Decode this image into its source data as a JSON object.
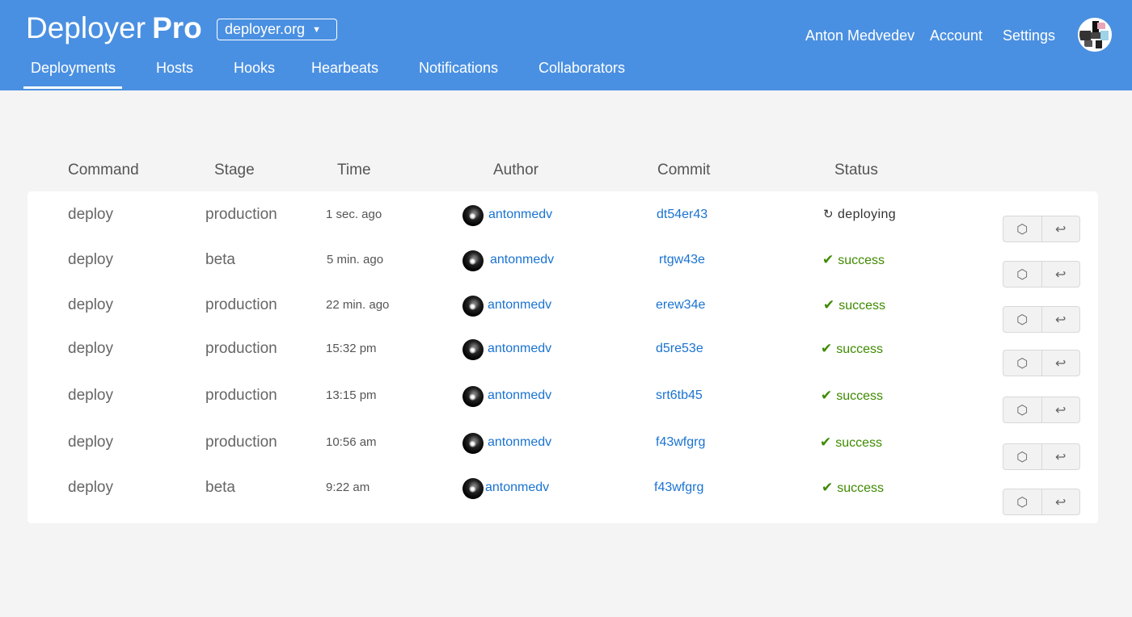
{
  "brand": {
    "name": "Deployer",
    "edition": "Pro"
  },
  "org_select": {
    "value": "deployer.org",
    "caret": "▼"
  },
  "nav": {
    "tabs": [
      {
        "label": "Deployments",
        "active": true
      },
      {
        "label": "Hosts"
      },
      {
        "label": "Hooks"
      },
      {
        "label": "Hearbeats"
      },
      {
        "label": "Notifications"
      },
      {
        "label": "Collaborators"
      }
    ]
  },
  "user": {
    "name": "Anton Medvedev",
    "account": "Account",
    "settings": "Settings"
  },
  "table": {
    "columns": [
      "Command",
      "Stage",
      "Time",
      "Author",
      "Commit",
      "Status"
    ],
    "rows": [
      {
        "command": "deploy",
        "stage": "production",
        "time": "1 sec. ago",
        "author": "antonmedv",
        "commit": "dt54er43",
        "status": "deploying",
        "status_icon": "↻",
        "actions": [
          "⬡",
          "↩"
        ]
      },
      {
        "command": "deploy",
        "stage": "beta",
        "time": "5 min. ago",
        "author": "antonmedv",
        "commit": "rtgw43e",
        "status": "success",
        "status_icon": "✔",
        "actions": [
          "⬡",
          "↩"
        ]
      },
      {
        "command": "deploy",
        "stage": "production",
        "time": "22 min. ago",
        "author": "antonmedv",
        "commit": "erew34e",
        "status": "success",
        "status_icon": "✔",
        "actions": [
          "⬡",
          "↩"
        ]
      },
      {
        "command": "deploy",
        "stage": "production",
        "time": "15:32 pm",
        "author": "antonmedv",
        "commit": "d5re53e",
        "status": "success",
        "status_icon": "✔",
        "actions": [
          "⬡",
          "↩"
        ]
      },
      {
        "command": "deploy",
        "stage": "production",
        "time": "13:15 pm",
        "author": "antonmedv",
        "commit": "srt6tb45",
        "status": "success",
        "status_icon": "✔",
        "actions": [
          "⬡",
          "↩"
        ]
      },
      {
        "command": "deploy",
        "stage": "production",
        "time": "10:56 am",
        "author": "antonmedv",
        "commit": "f43wfgrg",
        "status": "success",
        "status_icon": "✔",
        "actions": [
          "⬡",
          "↩"
        ]
      },
      {
        "command": "deploy",
        "stage": "beta",
        "time": "9:22 am",
        "author": "antonmedv",
        "commit": "f43wfgrg",
        "status": "success",
        "status_icon": "✔",
        "actions": [
          "⬡",
          "↩"
        ]
      }
    ]
  },
  "colors": {
    "header": "#4a90e2",
    "link": "#1a73d1",
    "success": "#3f8a00",
    "page_bg": "#f4f4f4"
  }
}
